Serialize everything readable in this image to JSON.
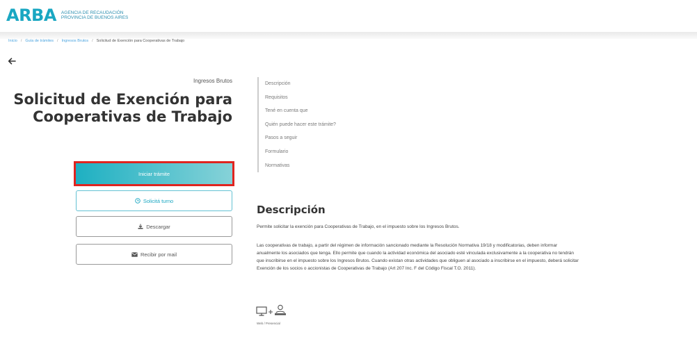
{
  "header": {
    "logo_text": "ARBA",
    "logo_sub_1": "Agencia de Recaudación",
    "logo_sub_2": "Provincia de Buenos Aires"
  },
  "breadcrumb": {
    "items": [
      "Inicio",
      "Guía de trámites",
      "Ingresos Brutos"
    ],
    "current": "Solicitud de Exención para Cooperativas de Trabajo"
  },
  "page": {
    "category": "Ingresos Brutos",
    "title_line1": "Solicitud de Exención para",
    "title_line2": "Cooperativas de Trabajo"
  },
  "actions": {
    "start": "Iniciar trámite",
    "turno": "Solicitá turno",
    "download": "Descargar",
    "mail": "Recibir por mail"
  },
  "toc": [
    "Descripción",
    "Requisitos",
    "Tené en cuenta que",
    "Quién puede hacer este trámite?",
    "Pasos a seguir",
    "Formulario",
    "Normativas"
  ],
  "description": {
    "title": "Descripción",
    "p1": "Permite solicitar la exención para Cooperativas de Trabajo, en el impuesto sobre los Ingresos Brutos.",
    "p2": "Las cooperativas de trabajo, a partir del régimen de información sancionado mediante la Resolución Normativa 19/18 y modificatorias, deben informar anualmente los asociados que tenga. Ello permite que cuando la actividad económica del asociado esté vinculada exclusivamente a la cooperativa no tendrán que inscribirse en el impuesto sobre los Ingresos Brutos. Cuando existan otras actividades que obliguen al asociado a inscribirse en el impuesto, deberá solicitar Exención de los socios o accionistas de Cooperativas de Trabajo (Art 207 Inc. F del Código Fiscal T.O. 2011)."
  },
  "channel": {
    "label": "Web / Presencial",
    "icons": [
      "computer-icon",
      "person-icon"
    ]
  },
  "colors": {
    "brand": "#1aa7c2",
    "highlight_border": "#e0241f",
    "link": "#4aa3df"
  }
}
